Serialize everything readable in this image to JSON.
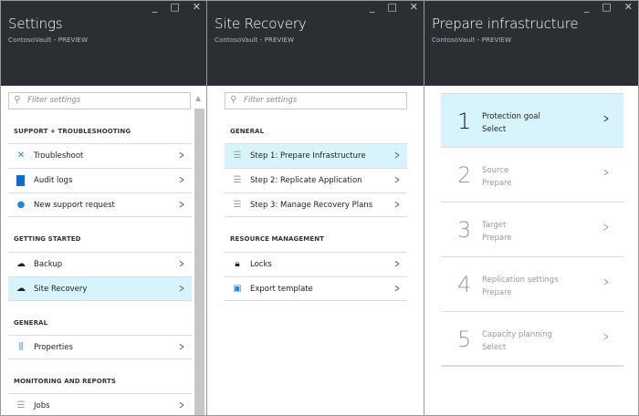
{
  "controls": {
    "minimize": "_",
    "maximize": "□",
    "close": "✕"
  },
  "settings": {
    "title": "Settings",
    "subtitle": "ContosoVault - PREVIEW",
    "filter_placeholder": "Filter settings",
    "sections": [
      {
        "label": "SUPPORT + TROUBLESHOOTING",
        "items": [
          {
            "label": "Troubleshoot",
            "icon": "wrench-icon"
          },
          {
            "label": "Audit logs",
            "icon": "book-icon"
          },
          {
            "label": "New support request",
            "icon": "support-person-icon"
          }
        ]
      },
      {
        "label": "GETTING STARTED",
        "items": [
          {
            "label": "Backup",
            "icon": "cloud-icon"
          },
          {
            "label": "Site Recovery",
            "icon": "cloud-icon",
            "selected": true
          }
        ]
      },
      {
        "label": "GENERAL",
        "items": [
          {
            "label": "Properties",
            "icon": "sliders-icon"
          }
        ]
      },
      {
        "label": "MONITORING AND REPORTS",
        "items": [
          {
            "label": "Jobs",
            "icon": "list-icon"
          }
        ]
      }
    ]
  },
  "site_recovery": {
    "title": "Site Recovery",
    "subtitle": "ContosoVault - PREVIEW",
    "filter_placeholder": "Filter settings",
    "sections": [
      {
        "label": "GENERAL",
        "items": [
          {
            "label": "Step 1: Prepare Infrastructure",
            "selected": true
          },
          {
            "label": "Step 2: Replicate Application"
          },
          {
            "label": "Step 3: Manage Recovery Plans"
          }
        ]
      },
      {
        "label": "RESOURCE MANAGEMENT",
        "items": [
          {
            "label": "Locks"
          },
          {
            "label": "Export template"
          }
        ]
      }
    ]
  },
  "prepare": {
    "title": "Prepare infrastructure",
    "subtitle": "ContosoVault - PREVIEW",
    "steps": [
      {
        "num": "1",
        "name": "Protection goal",
        "status": "Select"
      },
      {
        "num": "2",
        "name": "Source",
        "status": "Prepare"
      },
      {
        "num": "3",
        "name": "Target",
        "status": "Prepare"
      },
      {
        "num": "4",
        "name": "Replication settings",
        "status": "Prepare"
      },
      {
        "num": "5",
        "name": "Capacity planning",
        "status": "Select"
      }
    ]
  },
  "colors": {
    "header": "#2b2e33",
    "selected": "#d7f3fb"
  }
}
